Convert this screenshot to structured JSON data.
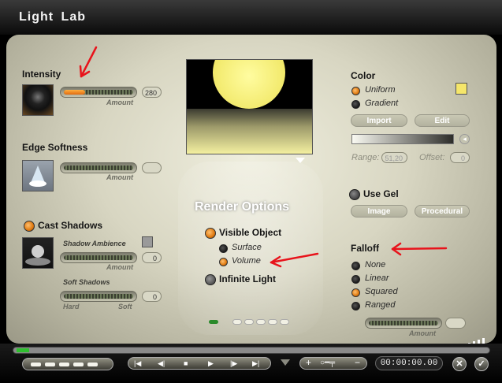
{
  "window": {
    "title": "Light  Lab"
  },
  "left": {
    "intensity": {
      "heading": "Intensity",
      "caption": "Amount",
      "value": "280",
      "level": 0.3
    },
    "edge_softness": {
      "heading": "Edge Softness",
      "caption": "Amount"
    },
    "cast_shadows": {
      "heading": "Cast Shadows",
      "ambience_label": "Shadow Ambience",
      "ambience_caption": "Amount",
      "ambience_value": "0",
      "soft_label": "Soft Shadows",
      "soft_value": "0",
      "hard_label": "Hard",
      "softend_label": "Soft"
    }
  },
  "center": {
    "render_options": "Render Options",
    "visible_object": "Visible Object",
    "surface": "Surface",
    "volume": "Volume",
    "infinite_light": "Infinite Light"
  },
  "right": {
    "color": {
      "heading": "Color",
      "uniform": "Uniform",
      "gradient": "Gradient",
      "import_label": "Import",
      "edit_label": "Edit",
      "range_label": "Range:",
      "range_value": "51,20",
      "offset_label": "Offset:",
      "offset_value": "0",
      "swatch": "#f5e66a"
    },
    "gel": {
      "heading": "Use Gel",
      "image_label": "Image",
      "procedural_label": "Procedural"
    },
    "falloff": {
      "heading": "Falloff",
      "none": "None",
      "linear": "Linear",
      "squared": "Squared",
      "ranged": "Ranged",
      "caption": "Amount"
    }
  },
  "transport": {
    "timecode": "00:00:00.00",
    "add_symbol": "+",
    "minus_symbol": "−"
  },
  "colors": {
    "accent": "#e07a10",
    "annotation": "#e8131b"
  }
}
